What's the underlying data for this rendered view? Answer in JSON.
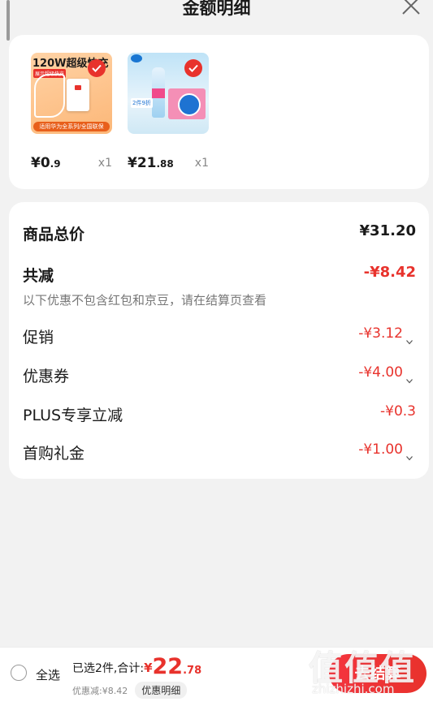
{
  "header": {
    "title": "金额明细"
  },
  "products": [
    {
      "image_title": "120W超级快充",
      "image_tag": "展示超级快充",
      "image_bottom": "适用华为全系列/全国联保",
      "price_int": "¥0",
      "price_dec": ".9",
      "qty": "x1",
      "icon": "charger-product-image"
    },
    {
      "image_side_text": "2件9折",
      "price_int": "¥21",
      "price_dec": ".88",
      "qty": "x1",
      "icon": "water-product-image"
    }
  ],
  "summary": {
    "total_label": "商品总价",
    "total_value": "¥31.20",
    "reduce_label": "共减",
    "reduce_value": "-¥8.42",
    "note": "以下优惠不包含红包和京豆，请在结算页查看",
    "items": [
      {
        "label": "促销",
        "value": "-¥3.12",
        "has_arrow": true
      },
      {
        "label": "优惠券",
        "value": "-¥4.00",
        "has_arrow": true
      },
      {
        "label": "PLUS专享立减",
        "value": "-¥0.3",
        "has_arrow": false
      },
      {
        "label": "首购礼金",
        "value": "-¥1.00",
        "has_arrow": true
      }
    ]
  },
  "footer": {
    "select_all": "全选",
    "selected_text": "已选2件,合计:",
    "currency": "¥",
    "total_int": "22",
    "total_dec": ".78",
    "discount_text": "优惠减:¥8.42",
    "detail_label": "优惠明细",
    "checkout_label": "去结算"
  },
  "watermark": {
    "big": "值值值",
    "small": "zhizhizhi.com"
  },
  "colors": {
    "accent": "#e8322c",
    "background": "#f2f2f2",
    "card": "#ffffff"
  }
}
